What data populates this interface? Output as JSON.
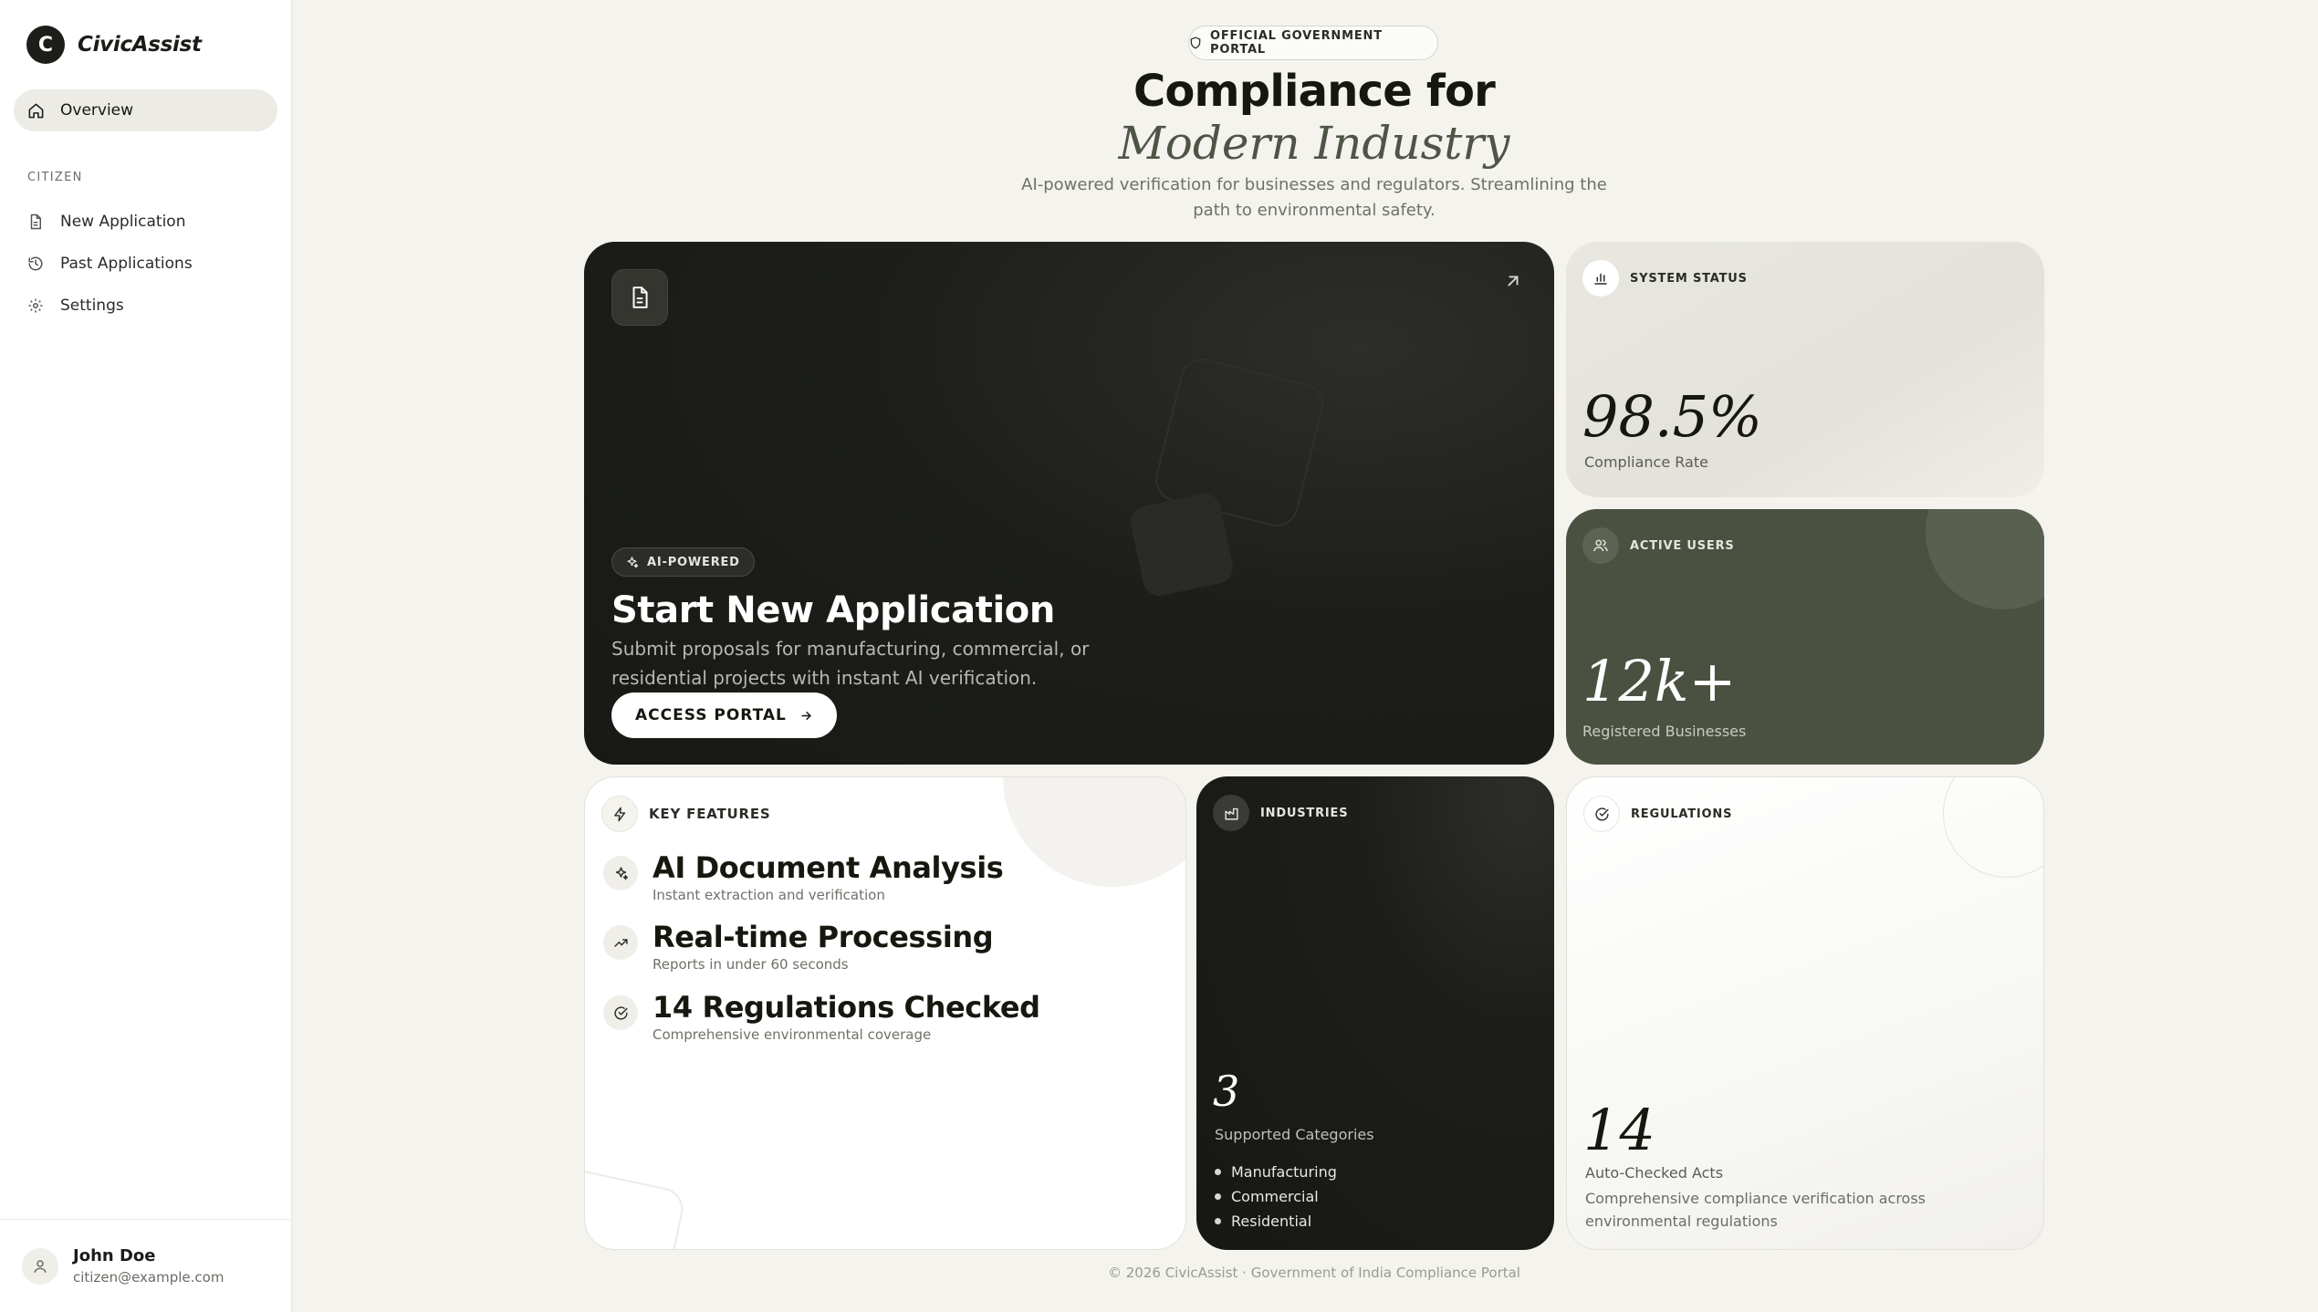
{
  "app": {
    "logo_letter": "C",
    "name": "CivicAssist"
  },
  "sidebar": {
    "active_item": {
      "label": "Overview",
      "icon": "home-icon"
    },
    "section_title": "CITIZEN",
    "items": [
      {
        "label": "New Application",
        "icon": "file-icon"
      },
      {
        "label": "Past Applications",
        "icon": "history-icon"
      },
      {
        "label": "Settings",
        "icon": "gear-icon"
      }
    ],
    "user": {
      "name": "John Doe",
      "email": "citizen@example.com"
    }
  },
  "header": {
    "badge": "OFFICIAL GOVERNMENT PORTAL",
    "title": "Compliance for",
    "title_italic": "Modern Industry",
    "subtitle": "AI-powered verification for businesses and regulators. Streamlining the path to environmental safety."
  },
  "hero": {
    "tag": "AI-POWERED",
    "title": "Start New Application",
    "description": "Submit proposals for manufacturing, commercial, or residential projects with instant AI verification.",
    "button": "ACCESS PORTAL"
  },
  "system_status": {
    "label": "SYSTEM STATUS",
    "value": "98.5%",
    "caption": "Compliance Rate"
  },
  "active_users": {
    "label": "ACTIVE USERS",
    "value": "12k+",
    "caption": "Registered Businesses"
  },
  "key_features": {
    "label": "KEY FEATURES",
    "items": [
      {
        "title": "AI Document Analysis",
        "subtitle": "Instant extraction and verification",
        "icon": "sparkle-icon"
      },
      {
        "title": "Real-time Processing",
        "subtitle": "Reports in under 60 seconds",
        "icon": "trending-up-icon"
      },
      {
        "title": "14 Regulations Checked",
        "subtitle": "Comprehensive environmental coverage",
        "icon": "check-circle-icon"
      }
    ]
  },
  "industries": {
    "label": "INDUSTRIES",
    "value": "3",
    "caption": "Supported Categories",
    "list": [
      "Manufacturing",
      "Commercial",
      "Residential"
    ]
  },
  "regulations": {
    "label": "REGULATIONS",
    "value": "14",
    "caption": "Auto-Checked Acts",
    "description": "Comprehensive compliance verification across environmental regulations"
  },
  "footer": {
    "text": "© 2026 CivicAssist · Government of India Compliance Portal"
  },
  "colors": {
    "dark": "#1d1e1a",
    "olive": "#4b5141",
    "background": "#f4f3ee"
  }
}
